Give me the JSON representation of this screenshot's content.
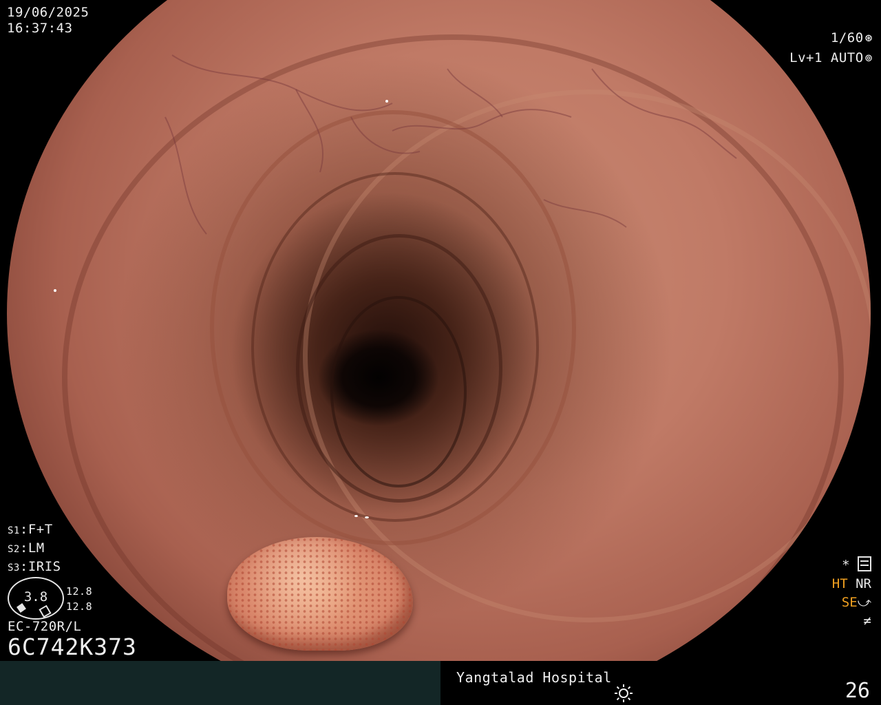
{
  "overlay": {
    "date": "19/06/2025",
    "time": "16:37:43",
    "shutter": "1/60",
    "shutter_icon": "shutter-icon",
    "level": "Lv+1",
    "mode": "AUTO",
    "mode_icon": "iris-mode-icon"
  },
  "settings": {
    "s1_key": "S1",
    "s1_value": "F+T",
    "s2_key": "S2",
    "s2_value": "LM",
    "s3_key": "S3",
    "s3_value": "IRIS"
  },
  "iris_gauge": {
    "value": "3.8",
    "top_value": "12.8",
    "bottom_value": "12.8"
  },
  "scope": {
    "model": "EC-720R/L",
    "serial": "6C742K373"
  },
  "status_right": {
    "star": "*",
    "ht": "HT",
    "nr": "NR",
    "se": "SE",
    "se_icon": "enhancement-icon",
    "extra_icon": "not-equal-icon",
    "ht_color": "#f0a020",
    "se_color": "#f0a020"
  },
  "bottom": {
    "hospital": "Yangtalad Hospital",
    "brightness_icon": "sun-icon",
    "counter": "26",
    "left_panel_color": "#132626"
  }
}
